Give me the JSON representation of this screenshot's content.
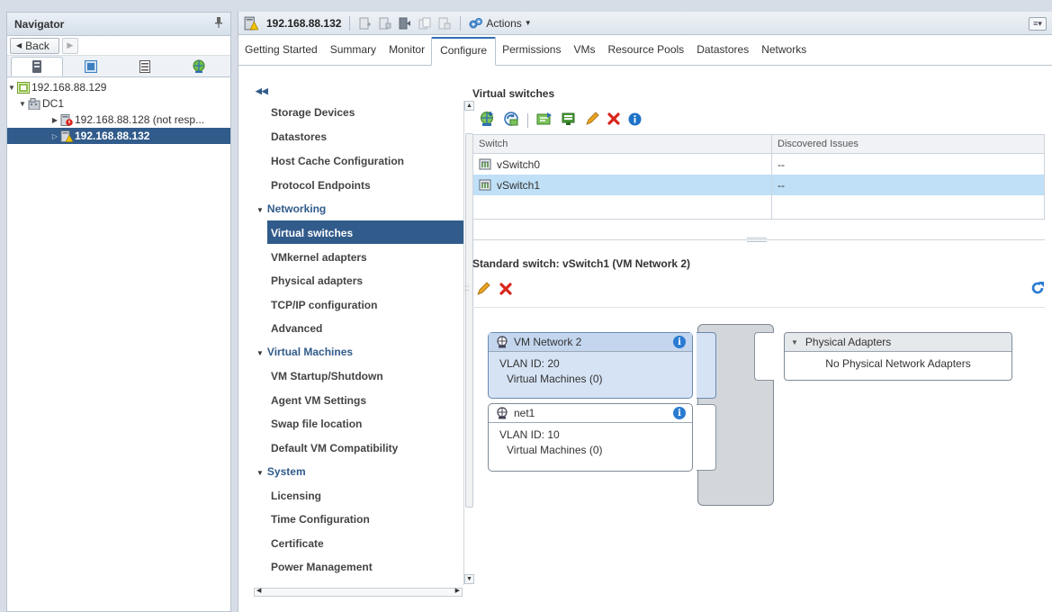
{
  "navigator": {
    "title": "Navigator",
    "back_label": "Back",
    "tree": [
      {
        "label": "192.168.88.129"
      },
      {
        "label": "DC1"
      },
      {
        "label": "192.168.88.128 (not resp..."
      },
      {
        "label": "192.168.88.132"
      }
    ]
  },
  "object_bar": {
    "title": "192.168.88.132",
    "actions_label": "Actions"
  },
  "tabs": [
    "Getting Started",
    "Summary",
    "Monitor",
    "Configure",
    "Permissions",
    "VMs",
    "Resource Pools",
    "Datastores",
    "Networks"
  ],
  "config_nav": {
    "items": [
      "Storage Devices",
      "Datastores",
      "Host Cache Configuration",
      "Protocol Endpoints",
      "Networking",
      "Virtual switches",
      "VMkernel adapters",
      "Physical adapters",
      "TCP/IP configuration",
      "Advanced",
      "Virtual Machines",
      "VM Startup/Shutdown",
      "Agent VM Settings",
      "Swap file location",
      "Default VM Compatibility",
      "System",
      "Licensing",
      "Time Configuration",
      "Certificate",
      "Power Management"
    ]
  },
  "virtual_switches": {
    "title": "Virtual switches",
    "columns": [
      "Switch",
      "Discovered Issues"
    ],
    "rows": [
      {
        "switch": "vSwitch0",
        "issues": "--"
      },
      {
        "switch": "vSwitch1",
        "issues": "--"
      }
    ]
  },
  "standard_switch": {
    "title": "Standard switch: vSwitch1 (VM Network 2)",
    "port_groups": [
      {
        "name": "VM Network 2",
        "vlan": "VLAN ID: 20",
        "vms": "Virtual Machines (0)"
      },
      {
        "name": "net1",
        "vlan": "VLAN ID: 10",
        "vms": "Virtual Machines (0)"
      }
    ],
    "physical_adapters": {
      "title": "Physical Adapters",
      "empty_text": "No Physical Network Adapters"
    }
  },
  "colors": {
    "selection": "#315b8b",
    "row_selection": "#bfe0f7",
    "accent_blue": "#2a7bd1",
    "delete_red": "#d9261c",
    "edit_orange": "#e8a320"
  }
}
